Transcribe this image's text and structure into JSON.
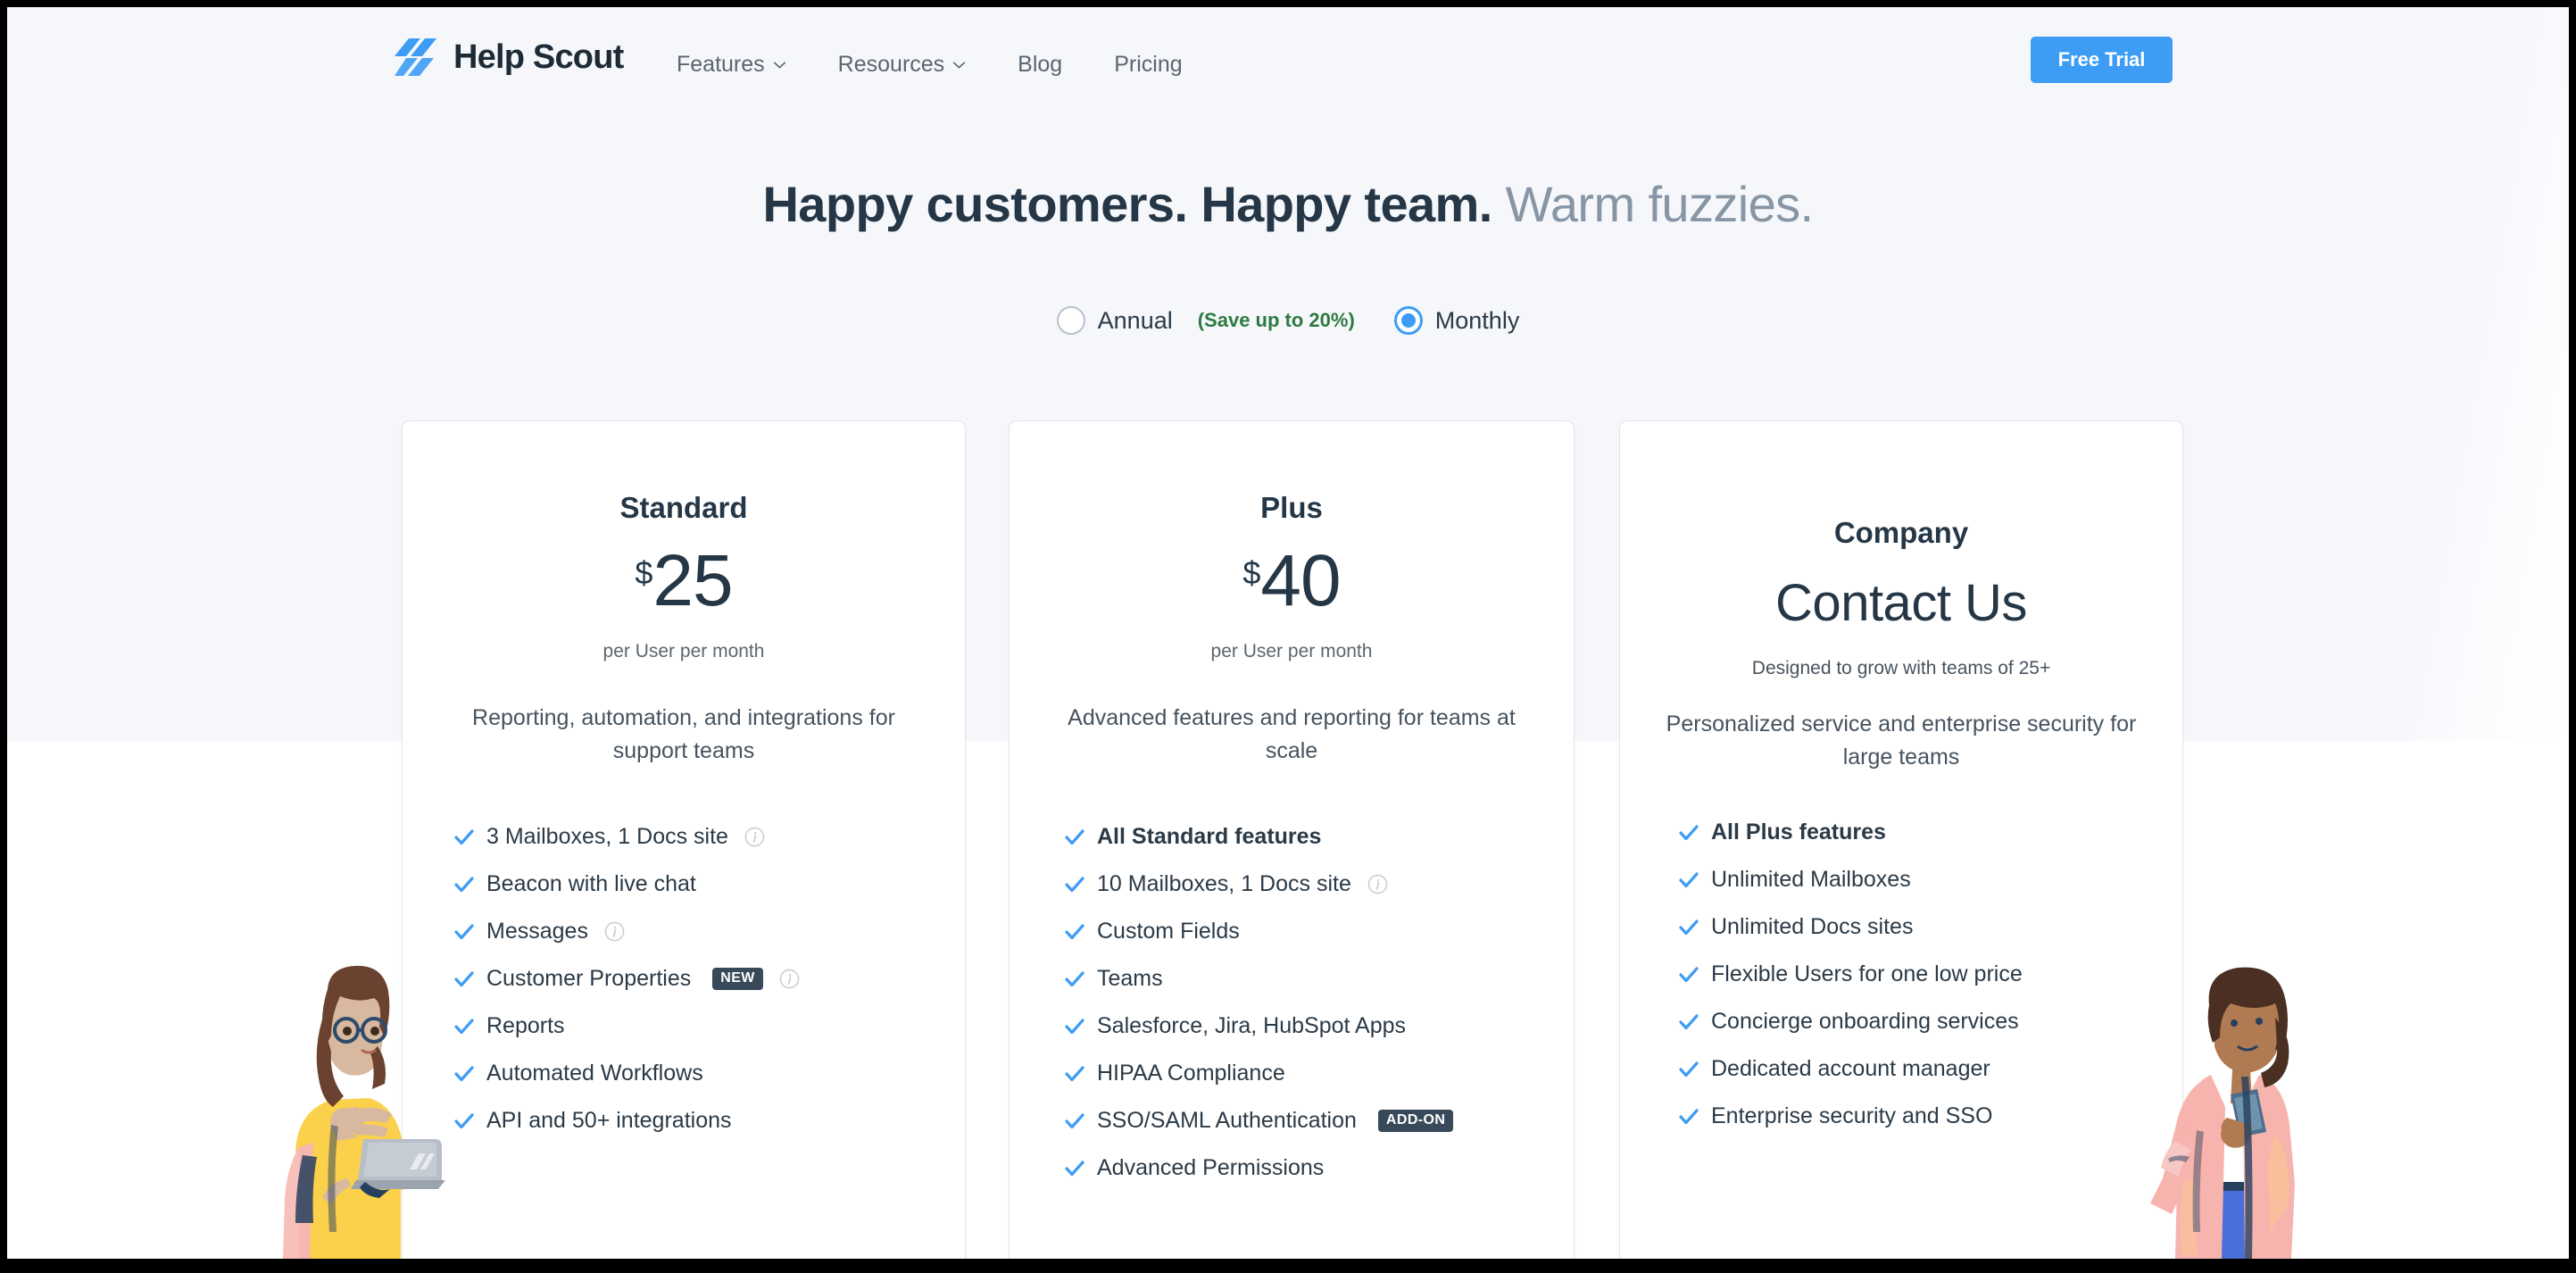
{
  "brand": {
    "logo_text": "Help Scout",
    "accent_blue": "#3d9cf4",
    "dark": "#253746",
    "green": "#2d7a41"
  },
  "header": {
    "nav": [
      {
        "label": "Features",
        "has_chevron": true,
        "icon": "chevron-down-icon"
      },
      {
        "label": "Resources",
        "has_chevron": true,
        "icon": "chevron-down-icon"
      },
      {
        "label": "Blog",
        "has_chevron": false
      },
      {
        "label": "Pricing",
        "has_chevron": false
      }
    ],
    "cta_label": "Free Trial"
  },
  "hero": {
    "headline_bold": "Happy customers. Happy team.",
    "headline_muted": " Warm fuzzies."
  },
  "billing": {
    "annual_label": "Annual",
    "annual_selected": false,
    "save_note": "(Save up to 20%)",
    "monthly_label": "Monthly",
    "monthly_selected": true
  },
  "plans": [
    {
      "name": "Standard",
      "currency": "$",
      "amount": "25",
      "per_unit": "per User per month",
      "blurb": "Reporting, automation, and integrations for support teams",
      "features": [
        {
          "text": "3 Mailboxes, 1 Docs site",
          "bold": false,
          "info": true,
          "badge": null
        },
        {
          "text": "Beacon with live chat",
          "bold": false,
          "info": false,
          "badge": null
        },
        {
          "text": "Messages",
          "bold": false,
          "info": true,
          "badge": null
        },
        {
          "text": "Customer Properties",
          "bold": false,
          "info": true,
          "badge": "NEW"
        },
        {
          "text": "Reports",
          "bold": false,
          "info": false,
          "badge": null
        },
        {
          "text": "Automated Workflows",
          "bold": false,
          "info": false,
          "badge": null
        },
        {
          "text": "API and 50+ integrations",
          "bold": false,
          "info": false,
          "badge": null
        }
      ]
    },
    {
      "name": "Plus",
      "currency": "$",
      "amount": "40",
      "per_unit": "per User per month",
      "blurb": "Advanced features and reporting for teams at scale",
      "features": [
        {
          "text": "All Standard features",
          "bold": true,
          "info": false,
          "badge": null
        },
        {
          "text": "10 Mailboxes, 1 Docs site",
          "bold": false,
          "info": true,
          "badge": null
        },
        {
          "text": "Custom Fields",
          "bold": false,
          "info": false,
          "badge": null
        },
        {
          "text": "Teams",
          "bold": false,
          "info": false,
          "badge": null
        },
        {
          "text": "Salesforce, Jira, HubSpot Apps",
          "bold": false,
          "info": false,
          "badge": null
        },
        {
          "text": "HIPAA Compliance",
          "bold": false,
          "info": false,
          "badge": null
        },
        {
          "text": "SSO/SAML Authentication",
          "bold": false,
          "info": false,
          "badge": "ADD-ON"
        },
        {
          "text": "Advanced Permissions",
          "bold": false,
          "info": false,
          "badge": null
        }
      ]
    },
    {
      "name": "Company",
      "contact_label": "Contact Us",
      "grow_note": "Designed to grow with teams of 25+",
      "blurb": "Personalized service and enterprise security for large teams",
      "features": [
        {
          "text": "All Plus features",
          "bold": true,
          "info": false,
          "badge": null
        },
        {
          "text": "Unlimited Mailboxes",
          "bold": false,
          "info": false,
          "badge": null
        },
        {
          "text": "Unlimited Docs sites",
          "bold": false,
          "info": false,
          "badge": null
        },
        {
          "text": "Flexible Users for one low price",
          "bold": false,
          "info": false,
          "badge": null
        },
        {
          "text": "Concierge onboarding services",
          "bold": false,
          "info": false,
          "badge": null
        },
        {
          "text": "Dedicated account manager",
          "bold": false,
          "info": false,
          "badge": null
        },
        {
          "text": "Enterprise security and SSO",
          "bold": false,
          "info": false,
          "badge": null
        }
      ]
    }
  ],
  "illustrations": {
    "left": "woman-with-laptop-illustration",
    "right": "woman-with-phone-illustration"
  }
}
